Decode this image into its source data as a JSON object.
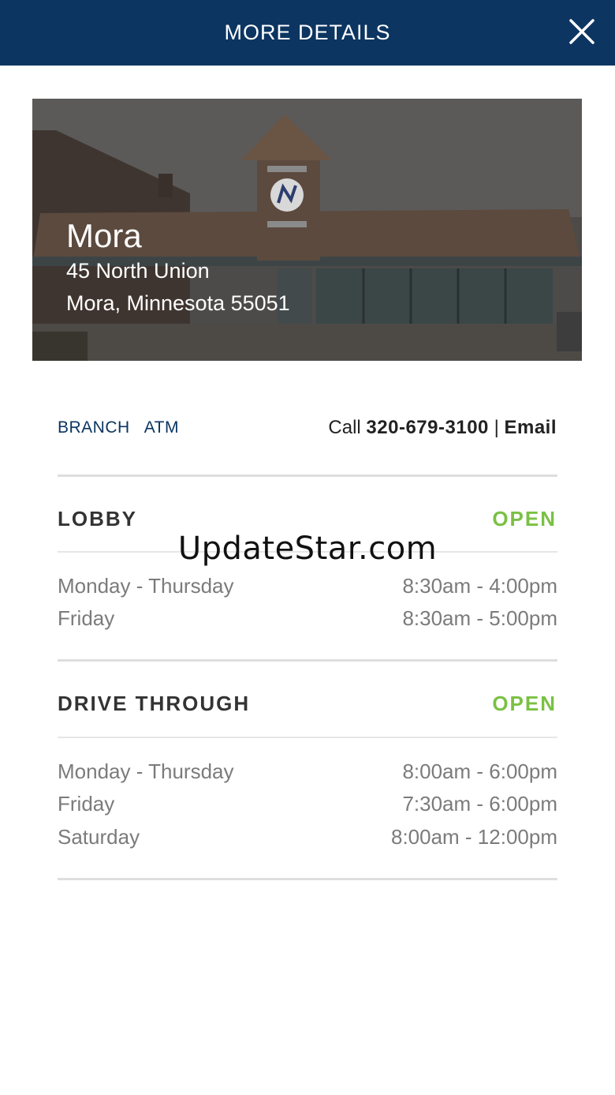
{
  "header": {
    "title": "MORE DETAILS",
    "close_icon": "close-icon"
  },
  "hero": {
    "name": "Mora",
    "address_line1": "45 North Union",
    "address_line2": "Mora, Minnesota 55051",
    "logo_icon": "bank-logo-icon"
  },
  "tabs": [
    {
      "label": "BRANCH"
    },
    {
      "label": "ATM"
    }
  ],
  "contact": {
    "call_label": "Call",
    "phone": "320-679-3100",
    "separator": "|",
    "email_label": "Email"
  },
  "lobby": {
    "title": "LOBBY",
    "status": "OPEN",
    "hours": [
      {
        "days": "Monday - Thursday",
        "time": "8:30am - 4:00pm"
      },
      {
        "days": "Friday",
        "time": "8:30am - 5:00pm"
      }
    ]
  },
  "drive_through": {
    "title": "DRIVE THROUGH",
    "status": "OPEN",
    "hours": [
      {
        "days": "Monday - Thursday",
        "time": "8:00am - 6:00pm"
      },
      {
        "days": "Friday",
        "time": "7:30am - 6:00pm"
      },
      {
        "days": "Saturday",
        "time": "8:00am - 12:00pm"
      }
    ]
  },
  "watermark": "UpdateStar.com",
  "colors": {
    "header_bg": "#0c3561",
    "open_green": "#7ac143",
    "tab_blue": "#0c3561"
  }
}
